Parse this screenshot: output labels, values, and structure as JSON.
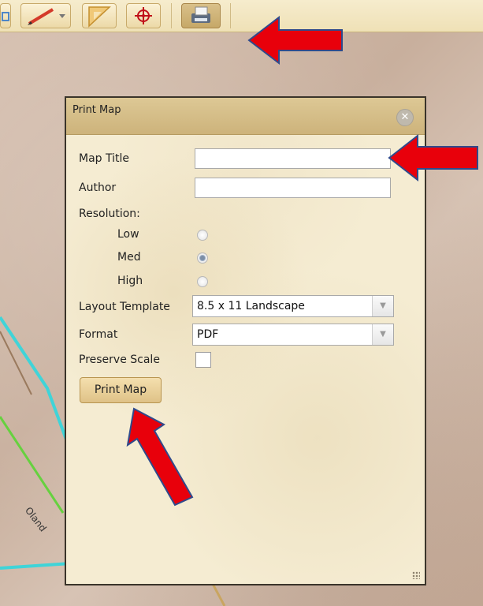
{
  "dialog": {
    "title": "Print Map",
    "close_icon": "close-icon",
    "fields": {
      "map_title_label": "Map Title",
      "map_title_value": "",
      "author_label": "Author",
      "author_value": "",
      "resolution_label": "Resolution:",
      "resolution_options": [
        "Low",
        "Med",
        "High"
      ],
      "resolution_selected": "Med",
      "layout_template_label": "Layout Template",
      "layout_template_value": "8.5 x 11 Landscape",
      "format_label": "Format",
      "format_value": "PDF",
      "preserve_scale_label": "Preserve Scale",
      "preserve_scale_checked": false
    },
    "print_button_label": "Print Map"
  },
  "map": {
    "street_label": "Oland"
  },
  "toolbar": {
    "icons": [
      "pencil-icon",
      "ruler-icon",
      "crosshair-icon",
      "printer-icon"
    ],
    "active": "printer-icon"
  },
  "colors": {
    "annotation_arrow": "#e8000b",
    "annotation_outline": "#2f4a8c",
    "road_cyan": "#3fd4d8",
    "road_green": "#66d13f"
  }
}
